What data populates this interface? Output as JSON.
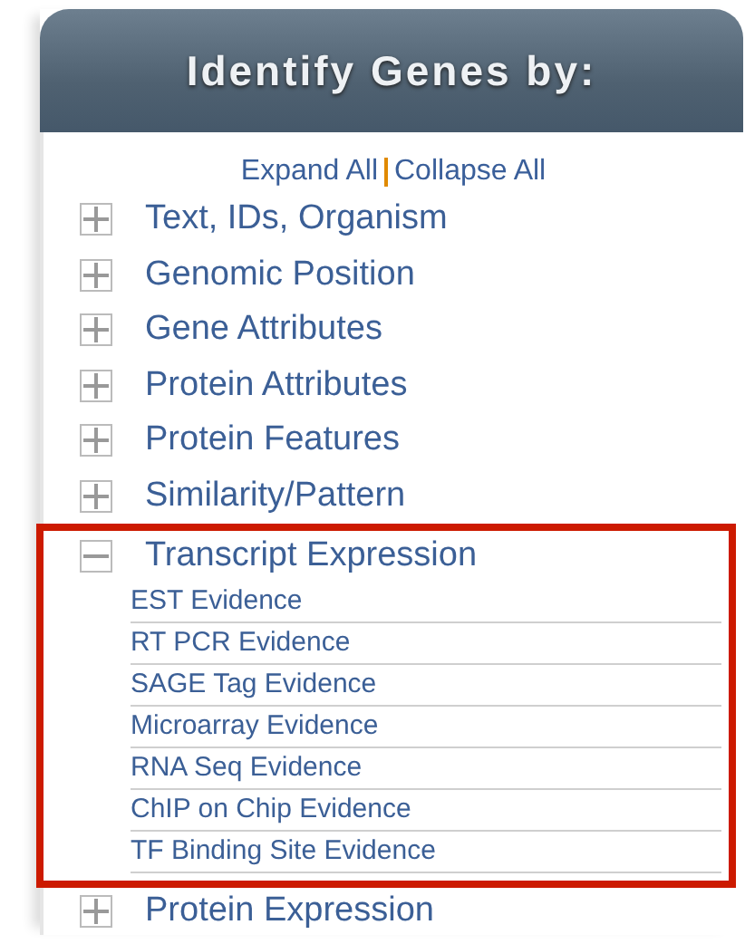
{
  "panel": {
    "title": "Identify Genes by:"
  },
  "links": [
    {
      "label": "Expand All"
    },
    {
      "label": "Collapse All"
    }
  ],
  "categories": [
    {
      "label": "Text, IDs, Organism",
      "expanded": false,
      "highlighted": false
    },
    {
      "label": "Genomic Position",
      "expanded": false,
      "highlighted": false
    },
    {
      "label": "Gene Attributes",
      "expanded": false,
      "highlighted": false
    },
    {
      "label": "Protein Attributes",
      "expanded": false,
      "highlighted": false
    },
    {
      "label": "Protein Features",
      "expanded": false,
      "highlighted": false
    },
    {
      "label": "Similarity/Pattern",
      "expanded": false,
      "highlighted": false
    },
    {
      "label": "Transcript Expression",
      "expanded": true,
      "highlighted": true,
      "children": [
        {
          "label": "EST Evidence"
        },
        {
          "label": "RT PCR Evidence"
        },
        {
          "label": "SAGE Tag Evidence"
        },
        {
          "label": "Microarray Evidence"
        },
        {
          "label": "RNA Seq Evidence"
        },
        {
          "label": "ChIP on Chip Evidence"
        },
        {
          "label": "TF Binding Site Evidence"
        }
      ]
    },
    {
      "label": "Protein Expression",
      "expanded": false,
      "highlighted": false
    }
  ]
}
